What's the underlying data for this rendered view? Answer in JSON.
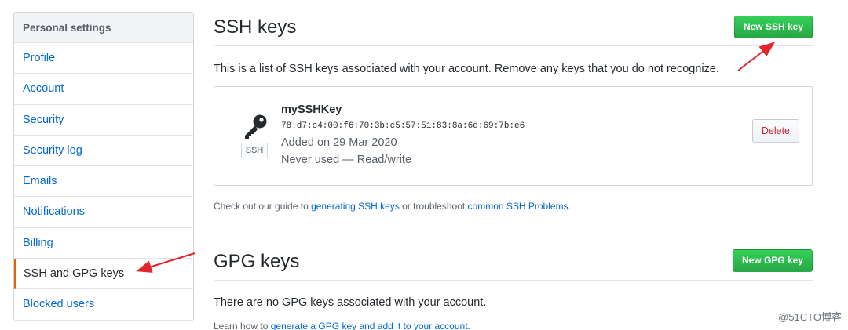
{
  "sidebar": {
    "header": "Personal settings",
    "items": [
      {
        "label": "Profile"
      },
      {
        "label": "Account"
      },
      {
        "label": "Security"
      },
      {
        "label": "Security log"
      },
      {
        "label": "Emails"
      },
      {
        "label": "Notifications"
      },
      {
        "label": "Billing"
      },
      {
        "label": "SSH and GPG keys",
        "selected": true
      },
      {
        "label": "Blocked users"
      }
    ]
  },
  "ssh": {
    "title": "SSH keys",
    "new_button": "New SSH key",
    "intro": "This is a list of SSH keys associated with your account. Remove any keys that you do not recognize.",
    "key": {
      "name": "mySSHKey",
      "fingerprint": "78:d7:c4:00:f6:70:3b:c5:57:51:83:8a:6d:69:7b:e6",
      "added": "Added on 29 Mar 2020",
      "usage": "Never used — Read/write",
      "badge": "SSH",
      "delete_button": "Delete",
      "icon": "key-icon"
    },
    "guide": {
      "prefix": "Check out our guide to ",
      "link1": "generating SSH keys",
      "middle": " or troubleshoot ",
      "link2": "common SSH Problems",
      "suffix": "."
    }
  },
  "gpg": {
    "title": "GPG keys",
    "new_button": "New GPG key",
    "empty": "There are no GPG keys associated with your account.",
    "learn": {
      "prefix": "Learn how to ",
      "link": "generate a GPG key and add it to your account",
      "suffix": "."
    }
  },
  "watermark": "@51CTO博客",
  "colors": {
    "link": "#0366d6",
    "green": "#28a745",
    "danger": "#cb2431",
    "selected_border": "#e36209",
    "arrow": "#e0262b"
  }
}
